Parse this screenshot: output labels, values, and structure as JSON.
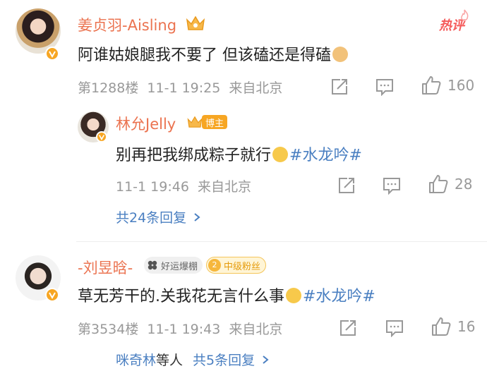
{
  "comments": [
    {
      "username": "姜贞羽-Aisling",
      "hot_label": "热评",
      "text": "阿谁姑娘腿我不要了 但该磕还是得磕",
      "floor": "第1288楼",
      "time": "11-1 19:25",
      "source": "来自北京",
      "like_count": "160",
      "reply": {
        "username": "林允Jelly",
        "badge": "博主",
        "text": "别再把我绑成粽子就行",
        "topic": "#水龙吟#",
        "time": "11-1 19:46",
        "source": "来自北京",
        "like_count": "28"
      },
      "more_replies": "共24条回复"
    },
    {
      "username": "-刘昱晗-",
      "tag_lucky": "好运爆棚",
      "tag_fan_level": "2",
      "tag_fan": "中级粉丝",
      "text": "草无芳干的.关我花无言什么事",
      "topic": "#水龙吟#",
      "floor": "第3534楼",
      "time": "11-1 19:43",
      "source": "来自北京",
      "like_count": "16",
      "more_prefix": "咪奇林",
      "more_mid": "等人",
      "more_replies": "共5条回复"
    }
  ],
  "colors": {
    "username": "#eb7350",
    "topic": "#4a7fc1",
    "meta": "#999999",
    "hot": "#f55a5a"
  }
}
